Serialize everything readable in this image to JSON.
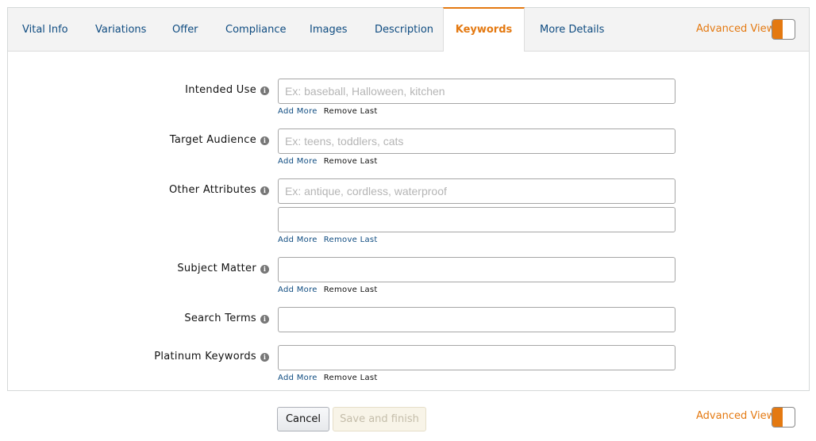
{
  "tabs": [
    {
      "label": "Vital Info",
      "active": false
    },
    {
      "label": "Variations",
      "active": false
    },
    {
      "label": "Offer",
      "active": false
    },
    {
      "label": "Compliance",
      "active": false
    },
    {
      "label": "Images",
      "active": false
    },
    {
      "label": "Description",
      "active": false
    },
    {
      "label": "Keywords",
      "active": true
    },
    {
      "label": "More Details",
      "active": false
    }
  ],
  "advanced_view": {
    "label": "Advanced View",
    "enabled": true
  },
  "info_icon_glyph": "i",
  "fields": {
    "intended_use": {
      "label": "Intended Use",
      "inputs": [
        {
          "value": "",
          "placeholder": "Ex: baseball, Halloween, kitchen"
        }
      ],
      "add_more": "Add More",
      "remove_last": "Remove Last"
    },
    "target_audience": {
      "label": "Target Audience",
      "inputs": [
        {
          "value": "",
          "placeholder": "Ex: teens, toddlers, cats"
        }
      ],
      "add_more": "Add More",
      "remove_last": "Remove Last"
    },
    "other_attributes": {
      "label": "Other Attributes",
      "inputs": [
        {
          "value": "",
          "placeholder": "Ex: antique, cordless, waterproof"
        },
        {
          "value": "",
          "placeholder": ""
        }
      ],
      "add_more": "Add More",
      "remove_last": "Remove Last"
    },
    "subject_matter": {
      "label": "Subject Matter",
      "inputs": [
        {
          "value": "",
          "placeholder": ""
        }
      ],
      "add_more": "Add More",
      "remove_last": "Remove Last"
    },
    "search_terms": {
      "label": "Search Terms",
      "inputs": [
        {
          "value": "",
          "placeholder": ""
        }
      ]
    },
    "platinum_keywords": {
      "label": "Platinum Keywords",
      "inputs": [
        {
          "value": "",
          "placeholder": ""
        }
      ],
      "add_more": "Add More",
      "remove_last": "Remove Last"
    }
  },
  "footer": {
    "cancel_label": "Cancel",
    "save_label": "Save and finish",
    "save_enabled": false
  },
  "colors": {
    "accent": "#e47911",
    "link": "#0f4c81",
    "tab_bar": "#f3f3f3"
  }
}
